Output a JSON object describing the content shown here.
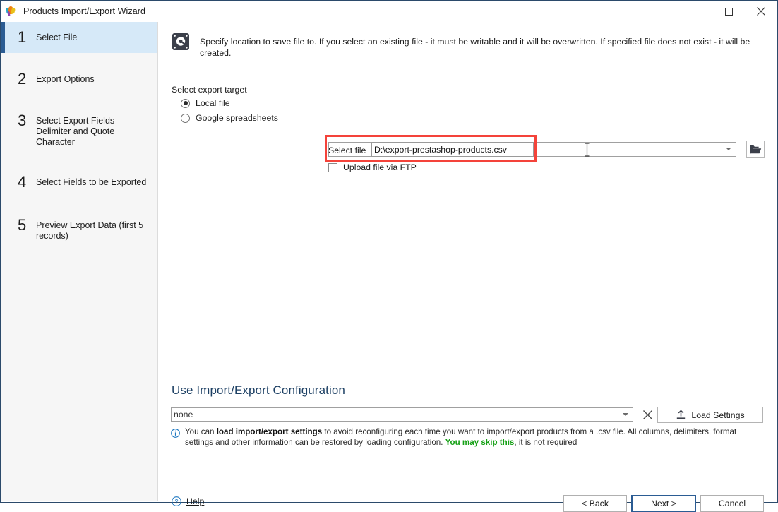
{
  "window": {
    "title": "Products Import/Export Wizard",
    "app_icon": "butterfly-icon",
    "maximize_label": "Maximize",
    "close_label": "Close"
  },
  "sidebar": {
    "steps": [
      {
        "num": "1",
        "label": "Select File",
        "selected": true
      },
      {
        "num": "2",
        "label": "Export Options",
        "selected": false
      },
      {
        "num": "3",
        "label": "Select Export Fields Delimiter and Quote Character",
        "selected": false
      },
      {
        "num": "4",
        "label": "Select Fields to be Exported",
        "selected": false
      },
      {
        "num": "5",
        "label": "Preview Export Data (first 5 records)",
        "selected": false
      }
    ]
  },
  "main": {
    "header_icon": "hard-disk-icon",
    "header_text": "Specify location to save file to. If you select an existing file - it must be writable and it will be overwritten. If specified file does not exist - it will be created.",
    "export_target": {
      "group_label": "Select export target",
      "options": [
        {
          "label": "Local file",
          "checked": true
        },
        {
          "label": "Google spreadsheets",
          "checked": false
        }
      ]
    },
    "select_file": {
      "label": "Select file",
      "value": "D:\\export-prestashop-products.csv",
      "placeholder": "",
      "browse_icon": "open-folder-icon",
      "dropdown_icon": "chevron-down-icon",
      "highlight_color": "#f4433a"
    },
    "ftp": {
      "label": "Upload file via FTP",
      "checked": false
    }
  },
  "config": {
    "title": "Use Import/Export Configuration",
    "combo_value": "none",
    "clear_icon": "close-x-icon",
    "load_button": {
      "label": "Load Settings",
      "icon": "upload-icon"
    },
    "info": {
      "icon": "info-icon",
      "part1": "You can ",
      "bold1": "load import/export settings",
      "part2": " to avoid reconfiguring each time you want to import/export products from a .csv file. All columns, delimiters, format settings and other information can be restored by loading configuration. ",
      "green": "You may skip this",
      "part3": ", it is not required"
    }
  },
  "footer": {
    "help": {
      "label": "Help",
      "icon": "help-circle-icon"
    },
    "back": "< Back",
    "next": "Next >",
    "cancel": "Cancel"
  }
}
